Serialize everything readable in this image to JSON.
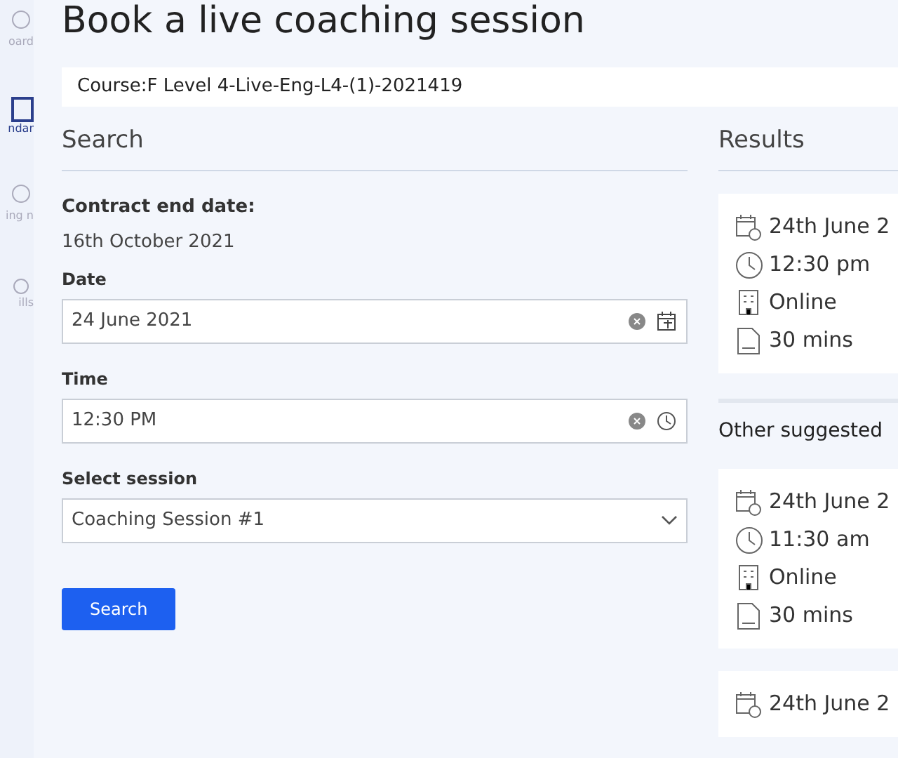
{
  "sidebar": {
    "items": [
      {
        "label": "oard",
        "selected": false
      },
      {
        "label": "ndar",
        "selected": true
      },
      {
        "label": "ing n",
        "selected": false
      },
      {
        "label": "ills",
        "selected": false
      }
    ]
  },
  "title": "Book a live coaching session",
  "course": "Course:F Level 4-Live-Eng-L4-(1)-2021419",
  "search": {
    "heading": "Search",
    "contract_label": "Contract end date:",
    "contract_value": "16th October 2021",
    "date": {
      "label": "Date",
      "value": "24 June 2021"
    },
    "time": {
      "label": "Time",
      "value": "12:30 PM"
    },
    "session": {
      "label": "Select session",
      "value": "Coaching Session #1"
    },
    "button": "Search"
  },
  "results": {
    "heading": "Results",
    "cards": [
      {
        "date": "24th June 2",
        "time": "12:30 pm",
        "place": "Online",
        "duration": "30 mins"
      }
    ],
    "suggested_heading": "Other suggested",
    "suggested": [
      {
        "date": "24th June 2",
        "time": "11:30 am",
        "place": "Online",
        "duration": "30 mins"
      },
      {
        "date": "24th June 2"
      }
    ]
  }
}
